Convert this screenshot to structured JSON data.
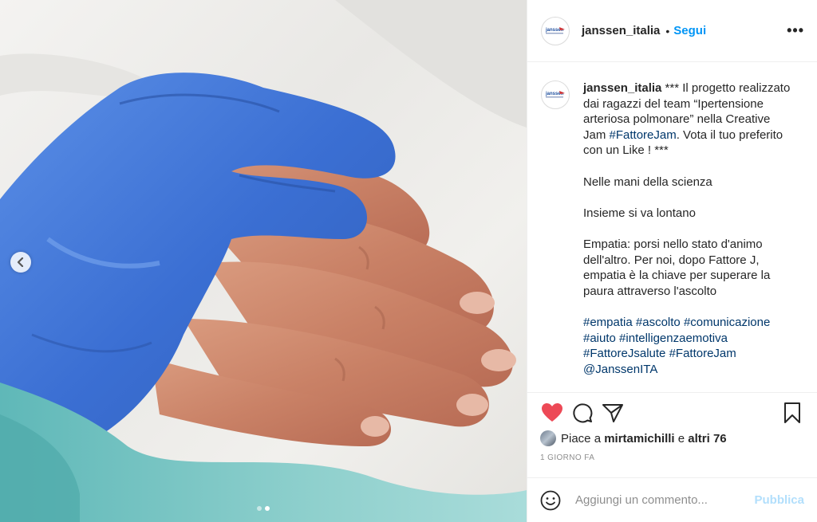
{
  "post": {
    "account": {
      "username": "janssen_italia",
      "follow_label": "Segui",
      "separator": "•",
      "more_label": "•••",
      "avatar_icon": "janssen-logo-icon"
    },
    "caption": {
      "username": "janssen_italia",
      "intro": " *** Il progetto realizzato dai ragazzi del team “Ipertensione arteriosa polmonare” nella Creative Jam ",
      "intro_tag": "#FattoreJam",
      "intro_end": ". Vota il tuo preferito con un Like ! ***",
      "paragraph_2": "Nelle mani della scienza",
      "paragraph_3": "Insieme si va lontano",
      "paragraph_4": "Empatia: porsi nello stato d'animo dell'altro. Per noi, dopo Fattore J, empatia è la chiave per superare la paura attraverso l'ascolto",
      "hashtags": [
        "#empatia",
        "#ascolto",
        "#comunicazione",
        "#aiuto",
        "#intelligenzaemotiva",
        "#FattoreJsalute",
        "#FattoreJam",
        "@JanssenITA"
      ]
    },
    "actions": {
      "like_icon": "heart-filled-icon",
      "comment_icon": "comment-icon",
      "share_icon": "paper-plane-icon",
      "save_icon": "bookmark-icon",
      "like_color": "#ed4956"
    },
    "likes": {
      "prefix": "Piace a",
      "user": "mirtamichilli",
      "connector": "e",
      "others": "altri 76"
    },
    "timestamp": "1 GIORNO FA",
    "add_comment": {
      "placeholder": "Aggiungi un commento...",
      "publish_label": "Pubblica",
      "emoji_icon": "smiley-icon",
      "publish_color": "#b2dffc"
    },
    "media": {
      "carousel_prev_icon": "chevron-left-icon",
      "slide_count": 2,
      "active_slide": 2,
      "glove_color": "#3b73d6"
    }
  }
}
